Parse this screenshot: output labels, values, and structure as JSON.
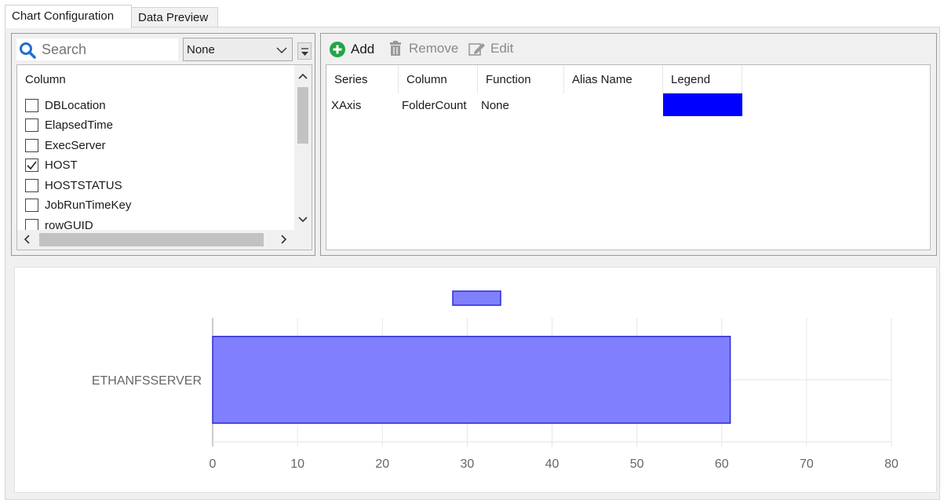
{
  "tabs": [
    {
      "label": "Chart Configuration",
      "active": true
    },
    {
      "label": "Data Preview",
      "active": false
    }
  ],
  "search": {
    "placeholder": "Search",
    "value": ""
  },
  "filter_combo": {
    "selected": "None"
  },
  "column_list": {
    "header": "Column",
    "items": [
      {
        "label": "DBLocation",
        "checked": false
      },
      {
        "label": "ElapsedTime",
        "checked": false
      },
      {
        "label": "ExecServer",
        "checked": false
      },
      {
        "label": "HOST",
        "checked": true
      },
      {
        "label": "HOSTSTATUS",
        "checked": false
      },
      {
        "label": "JobRunTimeKey",
        "checked": false
      },
      {
        "label": "rowGUID",
        "checked": false
      }
    ]
  },
  "toolbar": {
    "add_label": "Add",
    "remove_label": "Remove",
    "edit_label": "Edit"
  },
  "series_table": {
    "headers": [
      "Series",
      "Column",
      "Function",
      "Alias Name",
      "Legend"
    ],
    "rows": [
      {
        "series": "XAxis",
        "column": "FolderCount",
        "function": "None",
        "alias": "",
        "legend_color": "#0000ff"
      }
    ]
  },
  "colors": {
    "bar_fill": "#8080ff",
    "bar_stroke": "#2b2bd6",
    "legend_swatch": "#0000ff",
    "add_icon": "#22a544"
  },
  "chart_data": {
    "type": "bar",
    "orientation": "horizontal",
    "categories": [
      "ETHANFSSERVER"
    ],
    "series": [
      {
        "values": [
          61
        ]
      }
    ],
    "xlim": [
      0,
      80
    ],
    "xticks": [
      0,
      10,
      20,
      30,
      40,
      50,
      60,
      70,
      80
    ],
    "grid": true,
    "legend": "top-center",
    "title": "",
    "xlabel": "",
    "ylabel": ""
  }
}
